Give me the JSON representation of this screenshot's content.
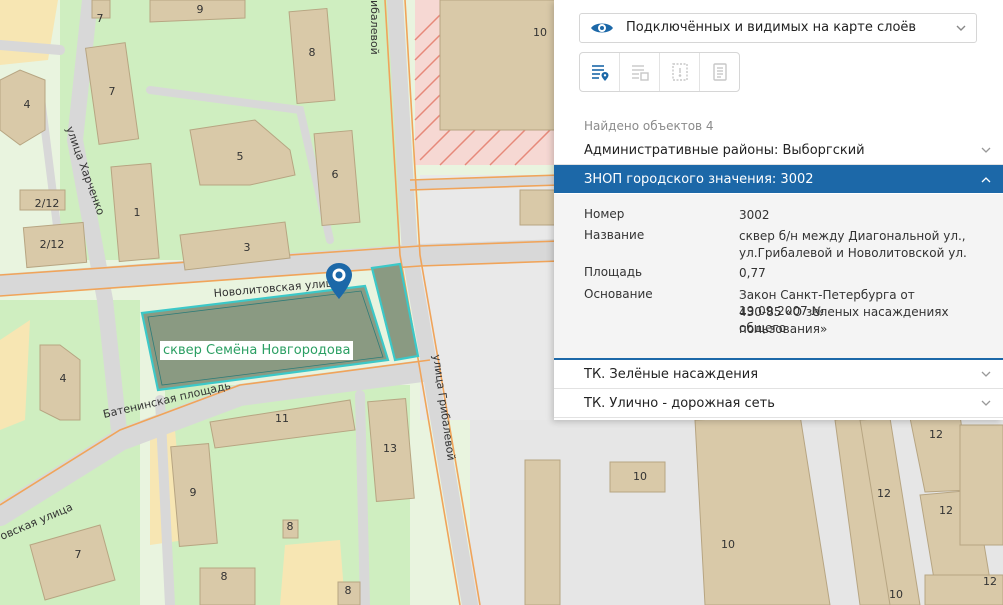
{
  "map": {
    "streets": {
      "kharchenko": "улица Харченко",
      "gribalevoy_top": "ибалевой",
      "gribalevoy": "улица Грибалевой",
      "novolitovskaya": "Новолитовская улица",
      "bateninskaya": "Батенинская площадь",
      "diagonal": "овская улица"
    },
    "park_name": "сквер Семёна Новгородова",
    "building_numbers": [
      "9",
      "7",
      "4",
      "7",
      "5",
      "8",
      "6",
      "1",
      "3",
      "2/12",
      "2/12",
      "10",
      "4",
      "11",
      "13",
      "9",
      "8",
      "7",
      "8",
      "8",
      "10",
      "12",
      "12",
      "12",
      "12",
      "10",
      "10"
    ]
  },
  "panel": {
    "layer_selector": {
      "label": "Подключённых и видимых на карте слоёв",
      "icon": "eye-icon"
    },
    "toolbar": [
      {
        "name": "list-pin-icon",
        "active": true
      },
      {
        "name": "list-table-icon",
        "active": false
      },
      {
        "name": "frame-icon",
        "active": false
      },
      {
        "name": "document-icon",
        "active": false
      }
    ],
    "found_text": "Найдено объектов 4",
    "sections": {
      "admin": "Административные районы: Выборгский",
      "znop": "ЗНОП городского значения: 3002",
      "tk_green": "ТК. Зелёные насаждения",
      "tk_road": "ТК. Улично - дорожная сеть"
    },
    "details": {
      "number": {
        "label": "Номер",
        "value": "3002"
      },
      "name": {
        "label": "Название",
        "value1": "сквер б/н между Диагональной ул.,",
        "value2": "ул.Грибалевой и Новолитовской ул."
      },
      "area": {
        "label": "Площадь",
        "value": "0,77"
      },
      "basis": {
        "label": "Основание",
        "value1": "Закон Санкт-Петербурга от 19.09.2007 №",
        "value2": "430-85 «О зеленых насаждениях общего",
        "value3": "пользования»"
      }
    }
  },
  "colors": {
    "accent": "#1c68a8",
    "park_fill": "#8a9a82",
    "park_outline": "#3cc8c8",
    "road_orange": "#f0a45a",
    "building": "#d9c9a8"
  }
}
